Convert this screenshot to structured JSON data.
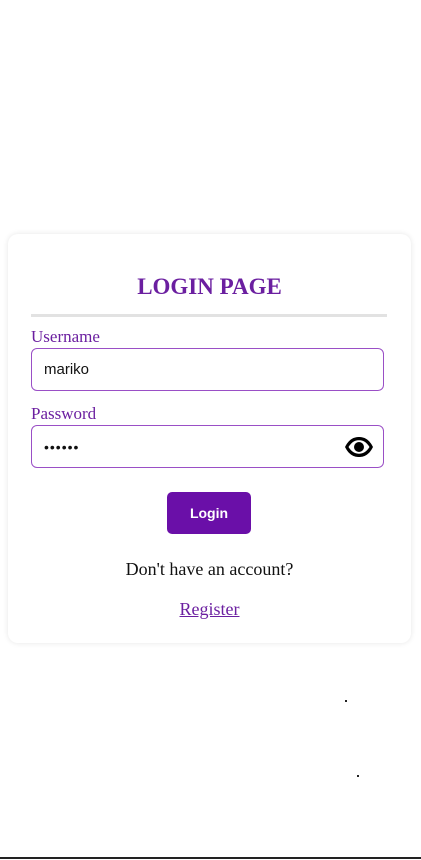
{
  "login_card": {
    "title": "LOGIN PAGE",
    "username": {
      "label": "Username",
      "value": "mariko"
    },
    "password": {
      "label": "Password",
      "masked_value": "••••••",
      "toggle_icon": "eye-icon"
    },
    "login_button_label": "Login",
    "no_account_text": "Don't have an account?",
    "register_link_text": "Register"
  },
  "colors": {
    "accent": "#6b1fa0",
    "button_bg": "#6a0fa8",
    "input_border": "#9a4fc6"
  }
}
